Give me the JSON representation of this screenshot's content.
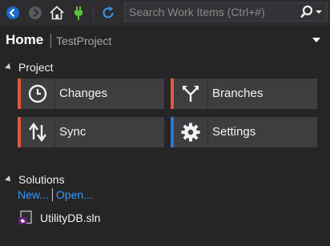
{
  "toolbar": {
    "icons": [
      "back-icon",
      "forward-icon",
      "home-icon",
      "connect-icon",
      "refresh-icon",
      "search-icon"
    ],
    "search_placeholder": "Search Work Items (Ctrl+#)"
  },
  "header": {
    "title": "Home",
    "project": "TestProject"
  },
  "project_section": {
    "label": "Project",
    "tiles": [
      {
        "label": "Changes",
        "icon": "clock-icon",
        "accent": "#e0593a"
      },
      {
        "label": "Branches",
        "icon": "branch-icon",
        "accent": "#e0593a"
      },
      {
        "label": "Sync",
        "icon": "sync-icon",
        "accent": "#e0593a"
      },
      {
        "label": "Settings",
        "icon": "gear-icon",
        "accent": "#1c7ed6"
      }
    ]
  },
  "solutions_section": {
    "label": "Solutions",
    "new_link": "New...",
    "open_link": "Open...",
    "items": [
      {
        "label": "UtilityDB.sln",
        "icon": "solution-file-icon"
      }
    ]
  },
  "colors": {
    "background": "#252526",
    "toolbar": "#2d2d30",
    "tile": "#3e3e40",
    "link": "#3399ff",
    "accent_orange": "#e0593a",
    "accent_blue": "#1c7ed6"
  }
}
